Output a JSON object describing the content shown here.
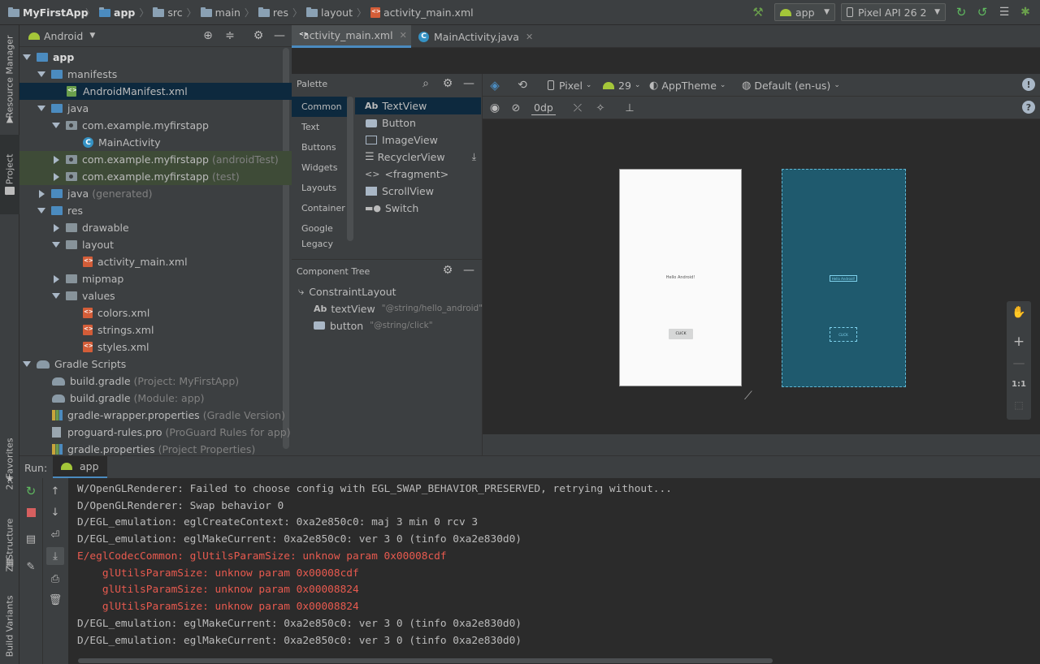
{
  "navbar": {
    "project": "MyFirstApp",
    "module": "app",
    "path": [
      "src",
      "main",
      "res",
      "layout"
    ],
    "file": "activity_main.xml",
    "run_config": "app",
    "device": "Pixel API 26  2"
  },
  "left_strip": {
    "resource_manager": "Resource Manager",
    "project": "1: Project",
    "favorites": "2: Favorites",
    "structure": "Z: Structure",
    "build_variants": "Build Variants"
  },
  "project_panel": {
    "view": "Android",
    "tree": [
      {
        "label": "app",
        "extra": ""
      },
      {
        "label": "manifests",
        "extra": ""
      },
      {
        "label": "AndroidManifest.xml",
        "extra": ""
      },
      {
        "label": "java",
        "extra": ""
      },
      {
        "label": "com.example.myfirstapp",
        "extra": ""
      },
      {
        "label": "MainActivity",
        "extra": ""
      },
      {
        "label": "com.example.myfirstapp",
        "extra": "(androidTest)"
      },
      {
        "label": "com.example.myfirstapp",
        "extra": "(test)"
      },
      {
        "label": "java",
        "extra": "(generated)"
      },
      {
        "label": "res",
        "extra": ""
      },
      {
        "label": "drawable",
        "extra": ""
      },
      {
        "label": "layout",
        "extra": ""
      },
      {
        "label": "activity_main.xml",
        "extra": ""
      },
      {
        "label": "mipmap",
        "extra": ""
      },
      {
        "label": "values",
        "extra": ""
      },
      {
        "label": "colors.xml",
        "extra": ""
      },
      {
        "label": "strings.xml",
        "extra": ""
      },
      {
        "label": "styles.xml",
        "extra": ""
      },
      {
        "label": "Gradle Scripts",
        "extra": ""
      },
      {
        "label": "build.gradle",
        "extra": "(Project: MyFirstApp)"
      },
      {
        "label": "build.gradle",
        "extra": "(Module: app)"
      },
      {
        "label": "gradle-wrapper.properties",
        "extra": "(Gradle Version)"
      },
      {
        "label": "proguard-rules.pro",
        "extra": "(ProGuard Rules for app)"
      },
      {
        "label": "gradle.properties",
        "extra": "(Project Properties)"
      }
    ]
  },
  "editor_tabs": [
    {
      "label": "activity_main.xml"
    },
    {
      "label": "MainActivity.java"
    }
  ],
  "palette": {
    "title": "Palette",
    "categories": [
      "Common",
      "Text",
      "Buttons",
      "Widgets",
      "Layouts",
      "Container",
      "Google",
      "Legacy"
    ],
    "items": [
      {
        "prefix": "Ab",
        "label": "TextView"
      },
      {
        "prefix": "",
        "label": "Button"
      },
      {
        "prefix": "",
        "label": "ImageView"
      },
      {
        "prefix": "",
        "label": "RecyclerView"
      },
      {
        "prefix": "<>",
        "label": "<fragment>"
      },
      {
        "prefix": "",
        "label": "ScrollView"
      },
      {
        "prefix": "",
        "label": "Switch"
      }
    ]
  },
  "component_tree": {
    "title": "Component Tree",
    "root": "ConstraintLayout",
    "children": [
      {
        "prefix": "Ab",
        "label": "textView",
        "value": "\"@string/hello_android\""
      },
      {
        "prefix": "",
        "label": "button",
        "value": "\"@string/click\""
      }
    ]
  },
  "design_toolbar": {
    "device": "Pixel",
    "api": "29",
    "theme": "AppTheme",
    "locale": "Default (en-us)",
    "margin": "0dp"
  },
  "preview": {
    "text": "Hello Android!",
    "button": "CLICK"
  },
  "zoom": {
    "ratio": "1:1"
  },
  "run": {
    "label": "Run:",
    "tab": "app",
    "lines": [
      {
        "text": "W/OpenGLRenderer: Failed to choose config with EGL_SWAP_BEHAVIOR_PRESERVED, retrying without...",
        "error": false
      },
      {
        "text": "D/OpenGLRenderer: Swap behavior 0",
        "error": false
      },
      {
        "text": "D/EGL_emulation: eglCreateContext: 0xa2e850c0: maj 3 min 0 rcv 3",
        "error": false
      },
      {
        "text": "D/EGL_emulation: eglMakeCurrent: 0xa2e850c0: ver 3 0 (tinfo 0xa2e830d0)",
        "error": false
      },
      {
        "text": "E/eglCodecCommon: glUtilsParamSize: unknow param 0x00008cdf",
        "error": true
      },
      {
        "text": "    glUtilsParamSize: unknow param 0x00008cdf",
        "error": true
      },
      {
        "text": "    glUtilsParamSize: unknow param 0x00008824",
        "error": true
      },
      {
        "text": "    glUtilsParamSize: unknow param 0x00008824",
        "error": true
      },
      {
        "text": "D/EGL_emulation: eglMakeCurrent: 0xa2e850c0: ver 3 0 (tinfo 0xa2e830d0)",
        "error": false
      },
      {
        "text": "D/EGL_emulation: eglMakeCurrent: 0xa2e850c0: ver 3 0 (tinfo 0xa2e830d0)",
        "error": false
      }
    ]
  },
  "colors": {
    "accent_blue": "#4b8bbf",
    "selected_row": "#0d293e",
    "test_row": "#3e4b37",
    "error_text": "#e85a4f",
    "blueprint": "#1f5a6e"
  }
}
